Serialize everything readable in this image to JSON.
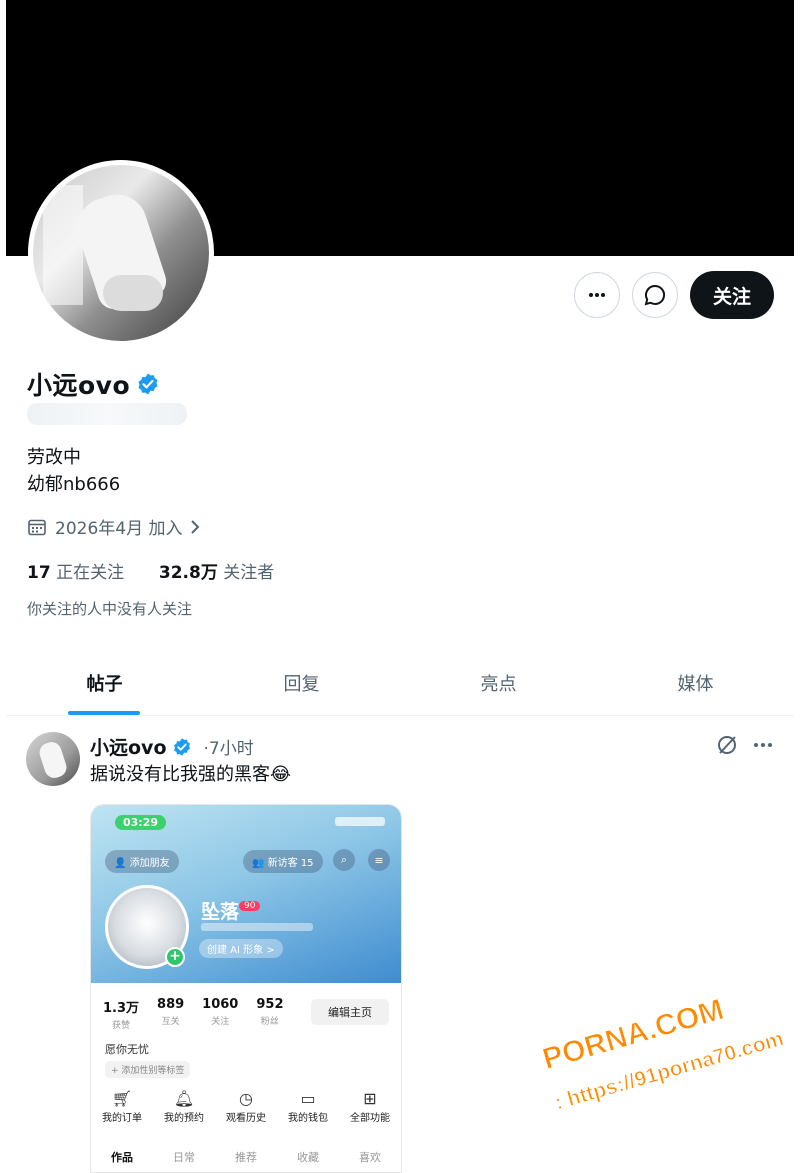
{
  "profile": {
    "name": "小远ovo",
    "bio_line1": "劳改中",
    "bio_line2": "幼郁nb666",
    "joined": "2026年4月 加入",
    "following_count": "17",
    "following_label": "正在关注",
    "followers_count": "32.8万",
    "followers_label": "关注者",
    "mutual_note": "你关注的人中没有人关注"
  },
  "actions": {
    "more_icon": "more-icon",
    "message_icon": "message-icon",
    "follow_label": "关注"
  },
  "tabs": [
    {
      "label": "帖子",
      "active": true
    },
    {
      "label": "回复",
      "active": false
    },
    {
      "label": "亮点",
      "active": false
    },
    {
      "label": "媒体",
      "active": false
    }
  ],
  "post": {
    "author": "小远ovo",
    "time": "·7小时",
    "text": "据说没有比我强的黑客😂",
    "embedded_screenshot": {
      "time": "03:29",
      "add_friend": "添加朋友",
      "new_visitors": "新访客 15",
      "username": "坠落",
      "level": "90",
      "ai_label": "创建 AI 形象 >",
      "stats": [
        {
          "value": "1.3万",
          "label": "获赞"
        },
        {
          "value": "889",
          "label": "互关"
        },
        {
          "value": "1060",
          "label": "关注"
        },
        {
          "value": "952",
          "label": "粉丝"
        }
      ],
      "edit_button": "编辑主页",
      "signature": "愿你无忧",
      "tag_hint": "+ 添加性别等标签",
      "quick_actions": [
        {
          "icon": "cart-icon",
          "label": "我的订单"
        },
        {
          "icon": "bell-icon",
          "label": "我的预约"
        },
        {
          "icon": "clock-icon",
          "label": "观看历史"
        },
        {
          "icon": "wallet-icon",
          "label": "我的钱包"
        },
        {
          "icon": "grid-icon",
          "label": "全部功能"
        }
      ],
      "tabs": [
        "作品",
        "日常",
        "推荐",
        "收藏",
        "喜欢"
      ]
    }
  },
  "watermark": {
    "line1": "PORNA.COM",
    "line2": "看完整版: https://91porna70.com"
  },
  "colors": {
    "accent": "#1d9bf0",
    "text": "#0f1419",
    "muted": "#536471",
    "banner": "#000000",
    "watermark": "#ff8a00"
  }
}
